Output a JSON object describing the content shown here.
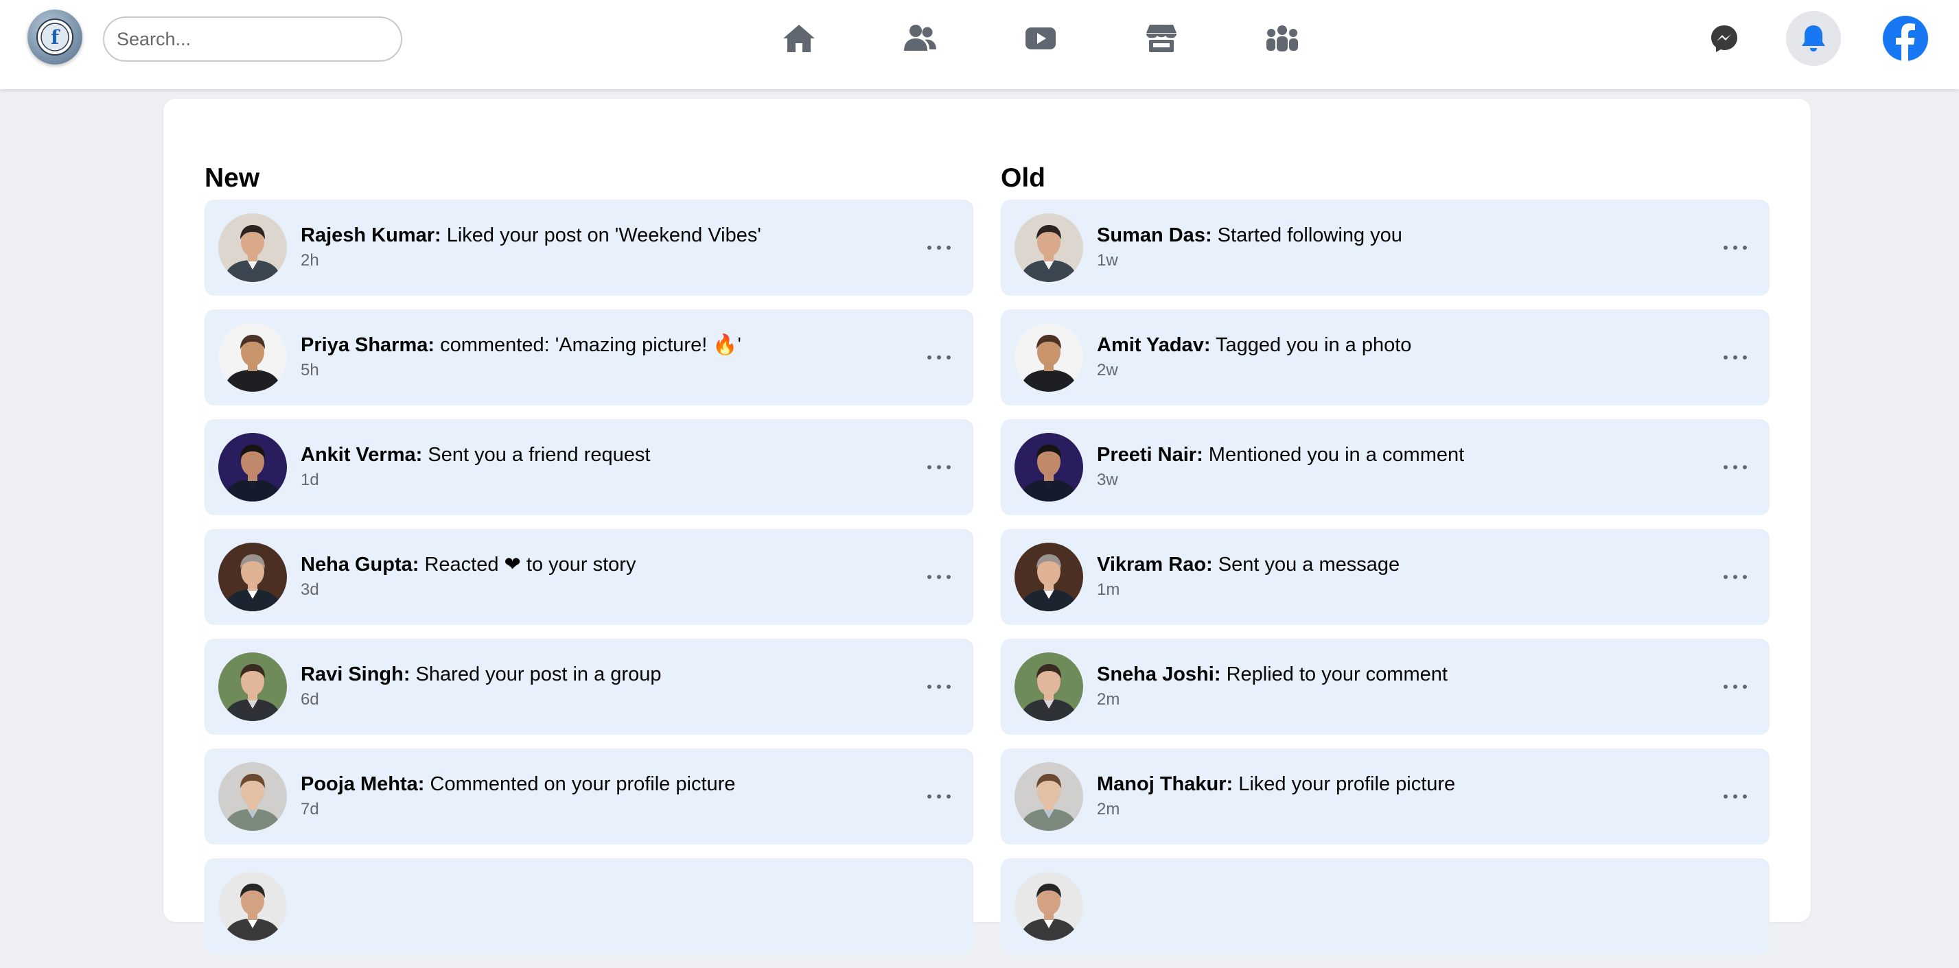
{
  "header": {
    "search_placeholder": "Search...",
    "nav": [
      {
        "name": "home-icon"
      },
      {
        "name": "friends-icon"
      },
      {
        "name": "video-icon"
      },
      {
        "name": "marketplace-icon"
      },
      {
        "name": "groups-icon"
      }
    ],
    "logo_letter": "f",
    "accent_color": "#1877f2"
  },
  "sections": {
    "new": {
      "title": "New",
      "items": [
        {
          "name": "Rajesh Kumar:",
          "text": "Liked your post on 'Weekend Vibes'",
          "time": "2h",
          "avatar": 0
        },
        {
          "name": "Priya Sharma:",
          "text": "commented: 'Amazing picture! 🔥'",
          "time": "5h",
          "avatar": 1
        },
        {
          "name": "Ankit Verma:",
          "text": "Sent you a friend request",
          "time": "1d",
          "avatar": 2
        },
        {
          "name": "Neha Gupta:",
          "text": "Reacted ❤ to your story",
          "time": "3d",
          "avatar": 3
        },
        {
          "name": "Ravi Singh:",
          "text": "Shared your post in a group",
          "time": "6d",
          "avatar": 4
        },
        {
          "name": "Pooja Mehta:",
          "text": "Commented on your profile picture",
          "time": "7d",
          "avatar": 5
        },
        {
          "name": "",
          "text": "",
          "time": "",
          "avatar": 6
        }
      ]
    },
    "old": {
      "title": "Old",
      "items": [
        {
          "name": "Suman Das:",
          "text": "Started following you",
          "time": "1w",
          "avatar": 0
        },
        {
          "name": "Amit Yadav:",
          "text": "Tagged you in a photo",
          "time": "2w",
          "avatar": 1
        },
        {
          "name": "Preeti Nair:",
          "text": "Mentioned you in a comment",
          "time": "3w",
          "avatar": 2
        },
        {
          "name": "Vikram Rao:",
          "text": "Sent you a message",
          "time": "1m",
          "avatar": 3
        },
        {
          "name": "Sneha Joshi:",
          "text": "Replied to your comment",
          "time": "2m",
          "avatar": 4
        },
        {
          "name": "Manoj Thakur:",
          "text": "Liked your profile picture",
          "time": "2m",
          "avatar": 5
        },
        {
          "name": "",
          "text": "",
          "time": "",
          "avatar": 6
        }
      ]
    }
  }
}
